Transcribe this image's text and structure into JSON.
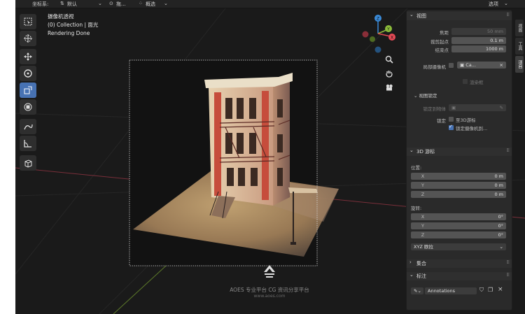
{
  "header": {
    "coord_label": "坐标系:",
    "coord_value": "默认",
    "item2": "拖...",
    "item3": "概选",
    "options": "选项"
  },
  "viewport": {
    "view_name": "摄像机透视",
    "collection": "(0) Collection | 面光",
    "status": "Rendering Done"
  },
  "toolbar": {
    "tools": [
      "select-box",
      "cursor",
      "move",
      "rotate",
      "scale",
      "transform",
      "annotate",
      "measure",
      "add-cube"
    ]
  },
  "gizmo": {
    "axes": [
      "Z",
      "Y",
      "X"
    ],
    "colors": {
      "x": "#e54a55",
      "y": "#8bbb3a",
      "z": "#3a8bd9"
    }
  },
  "npanel": {
    "view": {
      "title": "视图",
      "focal_label": "焦距",
      "focal_value": "50 mm",
      "clip_start_label": "裁剪起点",
      "clip_start_value": "0.1 m",
      "clip_end_label": "结束点",
      "clip_end_value": "1000 m",
      "local_camera_label": "局部摄像机",
      "local_camera_value": "Ca...",
      "render_region_label": "渲染框",
      "lock_sub": "视图锁定",
      "lock_to_object_label": "锁定到物体",
      "lock_label": "锁定",
      "lock_3d_cursor": "至3D游标",
      "lock_camera": "锁定摄像机到..."
    },
    "cursor": {
      "title": "3D 游标",
      "location_label": "位置:",
      "loc": [
        {
          "axis": "X",
          "value": "0 m"
        },
        {
          "axis": "Y",
          "value": "0 m"
        },
        {
          "axis": "Z",
          "value": "0 m"
        }
      ],
      "rotation_label": "旋转:",
      "rot": [
        {
          "axis": "X",
          "value": "0°"
        },
        {
          "axis": "Y",
          "value": "0°"
        },
        {
          "axis": "Z",
          "value": "0°"
        }
      ],
      "mode": "XYZ 欧拉"
    },
    "collection": {
      "title": "集合"
    },
    "annotation": {
      "title": "标注",
      "name": "Annotations"
    }
  },
  "tabs": [
    "视图",
    "工具",
    "项目"
  ],
  "watermark": {
    "line1": "AOES 专业平台 CG 资讯分享平台",
    "line2": "www.aoes.com"
  }
}
